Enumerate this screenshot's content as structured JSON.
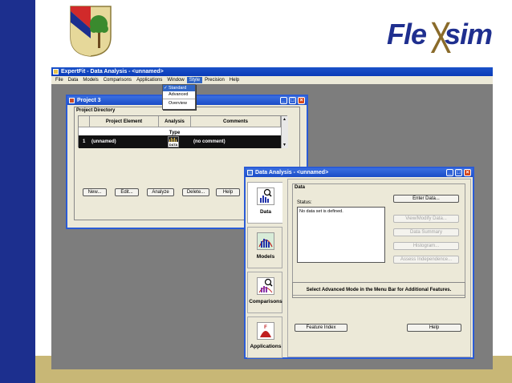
{
  "app": {
    "title": "ExpertFit - Data Analysis - <unnamed>",
    "menus": [
      "File",
      "Data",
      "Models",
      "Comparisons",
      "Applications",
      "Window",
      "Style",
      "Precision",
      "Help"
    ],
    "style_menu": {
      "items": [
        "Standard",
        "Advanced",
        "Overview"
      ],
      "checked": "Standard",
      "check_mark": "✓"
    }
  },
  "logo": {
    "brand_left": "Fle",
    "brand_right": "sim",
    "cross": "X"
  },
  "project": {
    "title": "Project 3",
    "directory_label": "Project Directory",
    "columns": [
      "Project Element",
      "Analysis Type",
      "Comments"
    ],
    "row": {
      "index": "1",
      "element": "(unnamed)",
      "comment": "(no comment)",
      "badge": "DATA"
    },
    "buttons": [
      "New...",
      "Edit...",
      "Analyze",
      "Delete...",
      "Help"
    ]
  },
  "data_analysis": {
    "title": "Data Analysis - <unnamed>",
    "tabs": [
      "Data",
      "Models",
      "Comparisons",
      "Applications"
    ],
    "group_label": "Data",
    "status_label": "Status:",
    "status_text": "No data set is defined.",
    "buttons": [
      "Enter Data...",
      "View/Modify Data...",
      "Data Summary",
      "Histogram...",
      "Assess Independence..."
    ],
    "note": "Select Advanced Mode in the Menu Bar for Additional Features.",
    "feature_index": "Feature Index",
    "help": "Help"
  },
  "colors": {
    "sidebar": "#1c2f8e",
    "bottom_bar": "#c8b776",
    "title_bar": "#1b52c9",
    "desktop": "#7d7d7d"
  }
}
